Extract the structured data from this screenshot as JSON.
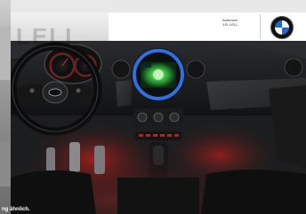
{
  "dealer": {
    "logo_text": "LELL",
    "name_line1": "Autohaus",
    "name_line2": "J.B. LELL"
  },
  "brand": {
    "logo_icon": "bmw-roundel-icon"
  },
  "photo": {
    "subject": "car-interior-dashboard",
    "screen_icon": "navigation-screen-icon",
    "wheel_icon": "steering-wheel-icon"
  },
  "footer": {
    "disclaimer": "ng ähnlich."
  },
  "colors": {
    "screen_ring": "#2f6fe0",
    "screen_glow": "#4fd84f",
    "ambient": "#c0201c",
    "bmw_blue": "#1c69d4"
  }
}
